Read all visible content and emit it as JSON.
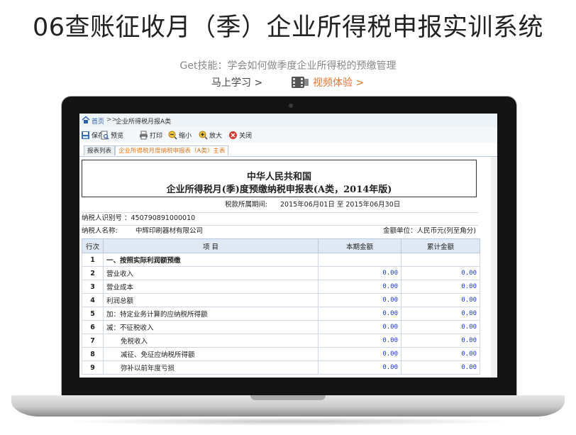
{
  "page": {
    "title": "06查账征收月（季）企业所得税申报实训系统",
    "tagline": "Get技能：学会如何做季度企业所得税的预缴管理",
    "learn_link": "马上学习 >",
    "video_link": "视频体验 >"
  },
  "app": {
    "breadcrumb": {
      "home": "首页",
      "separator": ">>",
      "current": "企业所得税月报A类"
    },
    "toolbar": [
      {
        "label": "保存",
        "icon": "save-icon"
      },
      {
        "label": "预览",
        "icon": "preview-icon"
      },
      {
        "label": "打印",
        "icon": "print-icon"
      },
      {
        "label": "缩小",
        "icon": "zoom-out-icon"
      },
      {
        "label": "放大",
        "icon": "zoom-in-icon"
      },
      {
        "label": "关闭",
        "icon": "close-icon"
      }
    ],
    "tabs": [
      {
        "label": "报表列表",
        "active": false
      },
      {
        "label": "企业所得税月度纳税申报表（A类）主表",
        "active": true
      }
    ],
    "accent_color": "#e0741c",
    "link_color": "#2a5fae",
    "amount_color": "#1a3bd6"
  },
  "report": {
    "title_line1": "中华人民共和国",
    "title_line2": "企业所得税月(季)度预缴纳税申报表(A类，2014年版)",
    "period_label": "税款所属期间:",
    "period_value": "2015年06月01日 至 2015年06月30日",
    "taxpayer_id_label": "纳税人识别号 ：",
    "taxpayer_id": "450790891000010",
    "taxpayer_name_label": "纳税人名称:",
    "taxpayer_name": "中辉印刷器材有限公司",
    "unit_label": "金额单位：",
    "unit_value": "人民币元(列至角分)",
    "columns": {
      "no": "行次",
      "item": "项          目",
      "current": "本期金额",
      "cumulative": "累计金额"
    },
    "rows": [
      {
        "no": "1",
        "item": "一、按照实际利润额预缴",
        "current": "",
        "cumulative": "",
        "style": "bold"
      },
      {
        "no": "2",
        "item": "营业收入",
        "current": "0.00",
        "cumulative": "0.00",
        "style": ""
      },
      {
        "no": "3",
        "item": "营业成本",
        "current": "0.00",
        "cumulative": "0.00",
        "style": ""
      },
      {
        "no": "4",
        "item": "利润总额",
        "current": "0.00",
        "cumulative": "0.00",
        "style": ""
      },
      {
        "no": "5",
        "item": "加：特定业务计算的应纳税所得额",
        "current": "0.00",
        "cumulative": "0.00",
        "style": ""
      },
      {
        "no": "6",
        "item": "减：不征税收入",
        "current": "0.00",
        "cumulative": "0.00",
        "style": ""
      },
      {
        "no": "7",
        "item": "免税收入",
        "current": "0.00",
        "cumulative": "0.00",
        "style": "indent"
      },
      {
        "no": "8",
        "item": "减征、免征应纳税所得额",
        "current": "0.00",
        "cumulative": "0.00",
        "style": "indent"
      },
      {
        "no": "9",
        "item": "弥补以前年度亏损",
        "current": "0.00",
        "cumulative": "0.00",
        "style": "indent"
      }
    ]
  }
}
